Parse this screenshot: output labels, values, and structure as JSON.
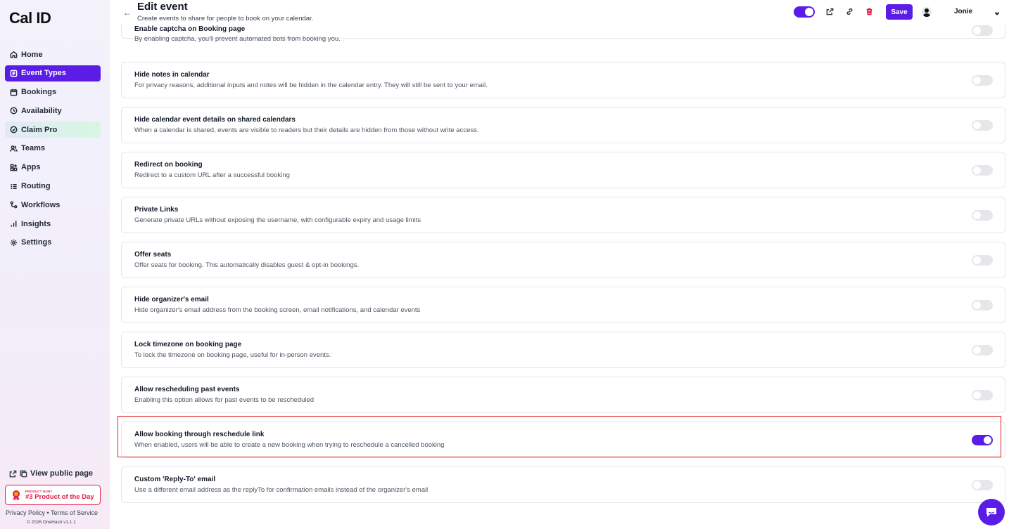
{
  "app": {
    "logo": "Cal ID"
  },
  "sidebar": {
    "items": [
      {
        "label": "Home",
        "icon": "home-icon"
      },
      {
        "label": "Event Types",
        "icon": "link-icon",
        "active": true
      },
      {
        "label": "Bookings",
        "icon": "calendar-icon"
      },
      {
        "label": "Availability",
        "icon": "clock-icon"
      },
      {
        "label": "Claim Pro",
        "icon": "badge-icon"
      },
      {
        "label": "Teams",
        "icon": "users-icon"
      },
      {
        "label": "Apps",
        "icon": "grid-icon"
      },
      {
        "label": "Routing",
        "icon": "list-icon"
      },
      {
        "label": "Workflows",
        "icon": "workflow-icon"
      },
      {
        "label": "Insights",
        "icon": "bar-chart-icon"
      },
      {
        "label": "Settings",
        "icon": "gear-icon"
      }
    ],
    "view_public_page": "View public page",
    "product_hunt": {
      "small": "PRODUCT HUNT",
      "big": "#3 Product of the Day"
    },
    "footer_links": "Privacy Policy • Terms of Service",
    "copyright": "© 2026 OneHash v1.1.1"
  },
  "header": {
    "title": "Edit event",
    "subtitle": "Create events to share for people to book on your calendar.",
    "save_label": "Save",
    "username": "Jonie",
    "toggle_on": true
  },
  "settings": [
    {
      "title": "Enable captcha on Booking page",
      "desc": "By enabling captcha, you'll prevent automated bots from booking you.",
      "on": false
    },
    {
      "title": "Hide notes in calendar",
      "desc": "For privacy reasons, additional inputs and notes will be hidden in the calendar entry. They will still be sent to your email.",
      "on": false
    },
    {
      "title": "Hide calendar event details on shared calendars",
      "desc": "When a calendar is shared, events are visible to readers but their details are hidden from those without write access.",
      "on": false
    },
    {
      "title": "Redirect on booking",
      "desc": "Redirect to a custom URL after a successful booking",
      "on": false
    },
    {
      "title": "Private Links",
      "desc": "Generate private URLs without exposing the username, with configurable expiry and usage limits",
      "on": false
    },
    {
      "title": "Offer seats",
      "desc": "Offer seats for booking. This automatically disables guest & opt-in bookings.",
      "on": false
    },
    {
      "title": "Hide organizer's email",
      "desc": "Hide organizer's email address from the booking screen, email notifications, and calendar events",
      "on": false
    },
    {
      "title": "Lock timezone on booking page",
      "desc": "To lock the timezone on booking page, useful for in-person events.",
      "on": false
    },
    {
      "title": "Allow rescheduling past events",
      "desc": "Enabling this option allows for past events to be rescheduled",
      "on": false
    },
    {
      "title": "Allow booking through reschedule link",
      "desc": "When enabled, users will be able to create a new booking when trying to reschedule a cancelled booking",
      "on": true
    },
    {
      "title": "Custom 'Reply-To' email",
      "desc": "Use a different email address as the replyTo for confirmation emails instead of the organizer's email",
      "on": false
    }
  ],
  "colors": {
    "accent": "#5b1ce8",
    "danger": "#e11d48",
    "highlight": "#dc2626"
  }
}
